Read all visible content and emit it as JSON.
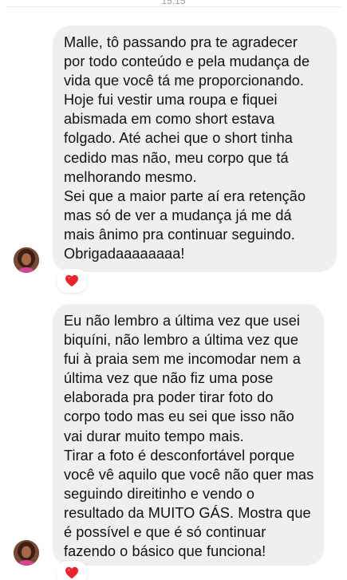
{
  "header": {
    "timestamp": "15:15"
  },
  "messages": [
    {
      "lines": [
        "Malle, tô passando pra te agradecer",
        "por todo conteúdo e pela mudança de",
        "vida que você tá me proporcionando.",
        "Hoje fui vestir uma roupa e fiquei",
        "abismada em como short estava",
        "folgado. Até achei que o short tinha",
        "cedido mas não, meu corpo que tá",
        "melhorando mesmo.",
        "Sei que a maior parte aí era retenção",
        "mas só de ver a mudança já me dá",
        "mais ânimo pra continuar seguindo.",
        "Obrigadaaaaaaaa!"
      ],
      "reaction": "❤️"
    },
    {
      "lines": [
        "Eu não lembro a última vez que usei",
        "biquíni, não lembro a última vez que",
        "fui à praia sem me incomodar nem a",
        "última vez que não fiz uma pose",
        "elaborada pra poder tirar foto do",
        "corpo todo mas eu sei  que isso não",
        "vai durar muito tempo mais.",
        "Tirar a foto é desconfortável porque",
        "você vê aquilo que você não quer mas",
        "seguindo direitinho e vendo o",
        "resultado da MUITO GÁS. Mostra que",
        "é possível e que é só continuar",
        "fazendo o básico que funciona!"
      ],
      "reaction": "❤️"
    }
  ],
  "colors": {
    "bubble_bg": "#efefef",
    "text": "#111111",
    "heart": "#e8232c",
    "background": "#ffffff"
  },
  "icons": {
    "avatar": "profile-photo",
    "reaction": "red-heart-icon"
  }
}
